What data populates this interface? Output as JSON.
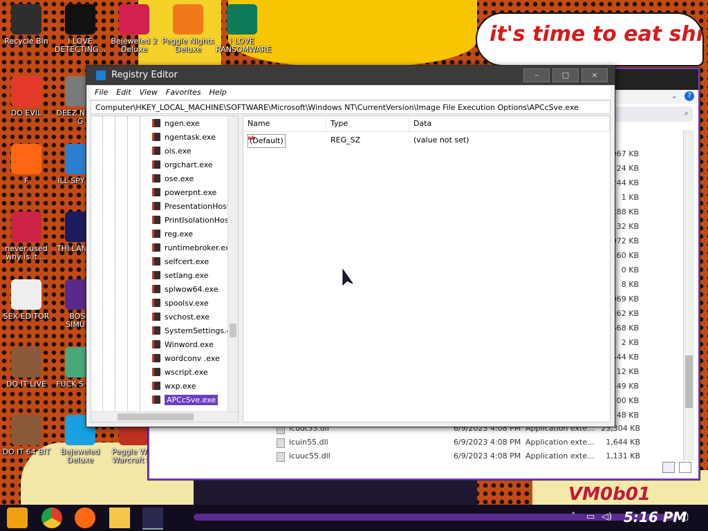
{
  "wallpaper": {
    "speech_text": "it's time to eat shit and die and chew",
    "watermark": "VM0b01"
  },
  "desktop_icons": [
    {
      "label": "Recycle Bin",
      "icon": "recycle-bin-icon",
      "color": "#2e2e2e"
    },
    {
      "label": "I LOVE DETECTING...",
      "icon": "detective-app-icon",
      "color": "#111111"
    },
    {
      "label": "Bejeweled 2 Deluxe",
      "icon": "bejeweled-icon",
      "color": "#d22050"
    },
    {
      "label": "Peggle Nights Deluxe",
      "icon": "peggle-icon",
      "color": "#f07a1a"
    },
    {
      "label": "I LOVE RANSOMWARE",
      "icon": "publisher-icon",
      "color": "#0d7a5a"
    },
    {
      "label": "DO EVIL",
      "icon": "chrome-icon",
      "color": "#e23b2b"
    },
    {
      "label": "DEEZ N HAH G",
      "icon": "folder-icon",
      "color": "#7a7a7a"
    },
    {
      "label": "F",
      "icon": "firefox-icon",
      "color": "#ff6611"
    },
    {
      "label": "ILL SPY YOU",
      "icon": "spy-icon",
      "color": "#2a7fd0"
    },
    {
      "label": "never used why is it ...",
      "icon": "devcpp-icon",
      "color": "#cc2244"
    },
    {
      "label": "THI LANGUA",
      "icon": "go-icon",
      "color": "#1b1b60"
    },
    {
      "label": "SEX EDITOR",
      "icon": "hxd-icon",
      "color": "#eeeeee"
    },
    {
      "label": "BOSN SIMULA",
      "icon": "virus-icon",
      "color": "#5a2a8a"
    },
    {
      "label": "DO IT LIVE",
      "icon": "portrait-icon",
      "color": "#8a5a3a"
    },
    {
      "label": "FUCK S ELVE",
      "icon": "elf-icon",
      "color": "#48a878"
    },
    {
      "label": "DO IT 64 BIT",
      "icon": "portrait-64-icon",
      "color": "#8a5a3a"
    },
    {
      "label": "Bejeweled Deluxe",
      "icon": "diamond-icon",
      "color": "#18a0e0"
    },
    {
      "label": "Peggle Worl Warcraft Ed",
      "icon": "peggle-wow-icon",
      "color": "#c03020"
    }
  ],
  "explorer": {
    "sizes": [
      "967 KB",
      "24 KB",
      "244 KB",
      "1 KB",
      "288 KB",
      "32 KB",
      "072 KB",
      "160 KB",
      "0 KB",
      "8 KB",
      "969 KB",
      "262 KB",
      "568 KB",
      "2 KB",
      "544 KB",
      "12 KB",
      "449 KB",
      "100 KB",
      "48 KB"
    ],
    "rows": [
      {
        "name": "icudt55.dll",
        "date": "6/9/2023 4:08 PM",
        "type": "Application exte...",
        "size": "25,304 KB"
      },
      {
        "name": "icuin55.dll",
        "date": "6/9/2023 4:08 PM",
        "type": "Application exte...",
        "size": "1,644 KB"
      },
      {
        "name": "icuuc55.dll",
        "date": "6/9/2023 4:08 PM",
        "type": "Application exte...",
        "size": "1,131 KB"
      }
    ]
  },
  "regedit": {
    "title": "Registry Editor",
    "window_buttons": {
      "minimize": "–",
      "maximize": "□",
      "close": "×"
    },
    "menu": [
      "File",
      "Edit",
      "View",
      "Favorites",
      "Help"
    ],
    "address": "Computer\\HKEY_LOCAL_MACHINE\\SOFTWARE\\Microsoft\\Windows NT\\CurrentVersion\\Image File Execution Options\\APCcSve.exe",
    "tree_items": [
      "ngen.exe",
      "ngentask.exe",
      "ois.exe",
      "orgchart.exe",
      "ose.exe",
      "powerpnt.exe",
      "PresentationHost.",
      "PrintIsolationHos",
      "reg.exe",
      "runtimebroker.ex",
      "selfcert.exe",
      "setlang.exe",
      "splwow64.exe",
      "spoolsv.exe",
      "svchost.exe",
      "SystemSettings.e",
      "Winword.exe",
      "wordconv .exe",
      "wscript.exe",
      "wxp.exe",
      "APCcSve.exe"
    ],
    "selected_item": "APCcSve.exe",
    "columns": [
      "Name",
      "Type",
      "Data"
    ],
    "values": [
      {
        "name": "(Default)",
        "type": "REG_SZ",
        "data": "(value not set)"
      }
    ]
  },
  "taskbar": {
    "clock": "5:16 PM",
    "apps": [
      "start-icon",
      "chrome-icon",
      "firefox-icon",
      "file-explorer-icon",
      "registry-editor-icon"
    ]
  }
}
